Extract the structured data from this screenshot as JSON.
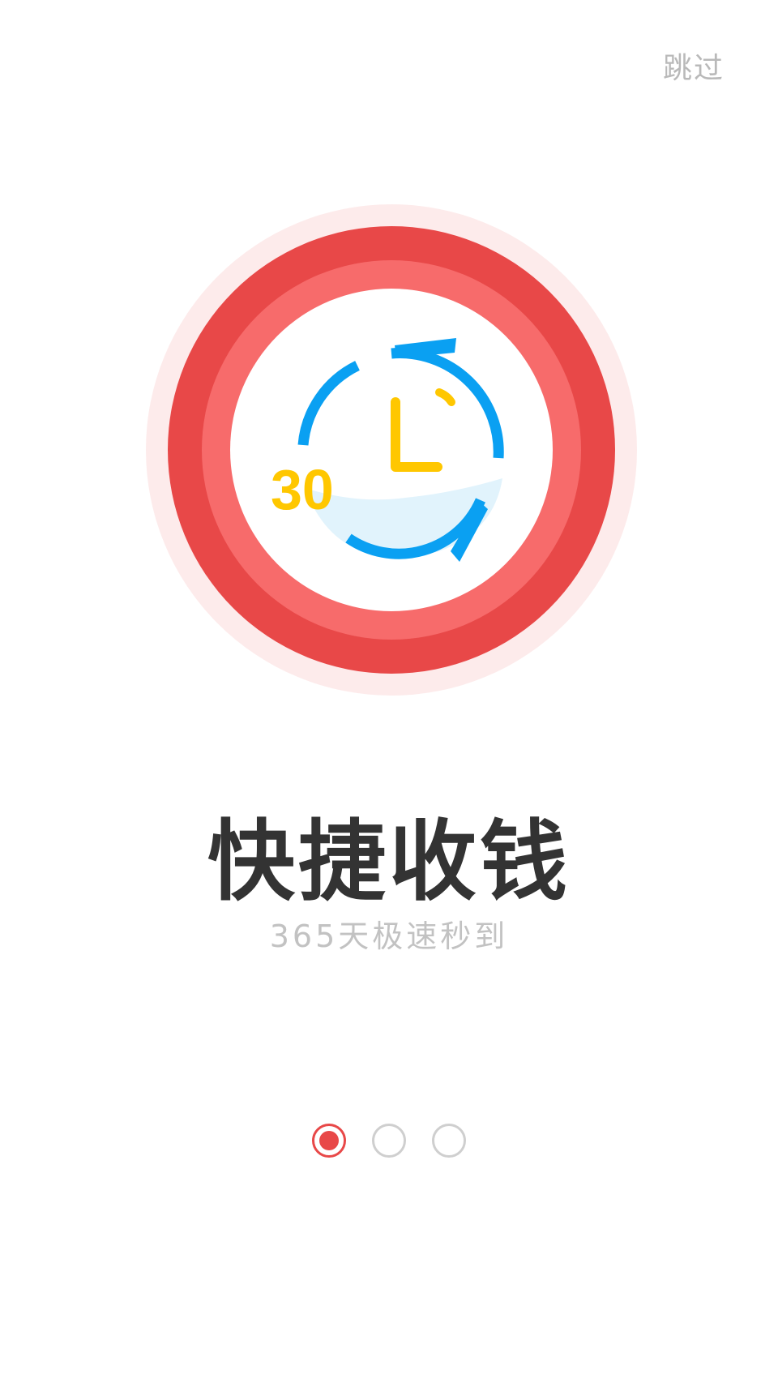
{
  "header": {
    "skip_label": "跳过"
  },
  "illustration": {
    "number_text": "30",
    "icon": "clock-refresh-icon",
    "colors": {
      "halo": "#fdebeb",
      "outer_ring": "#e84848",
      "inner_ring": "#f76b6b",
      "face": "#ffffff",
      "arrow": "#0aa0f2",
      "accent": "#ffc700",
      "wave": "#e1f3fc"
    }
  },
  "content": {
    "title": "快捷收钱",
    "subtitle": "365天极速秒到"
  },
  "pager": {
    "total": 3,
    "active_index": 0,
    "active_color": "#e84848",
    "inactive_color": "#cfcfcf"
  }
}
